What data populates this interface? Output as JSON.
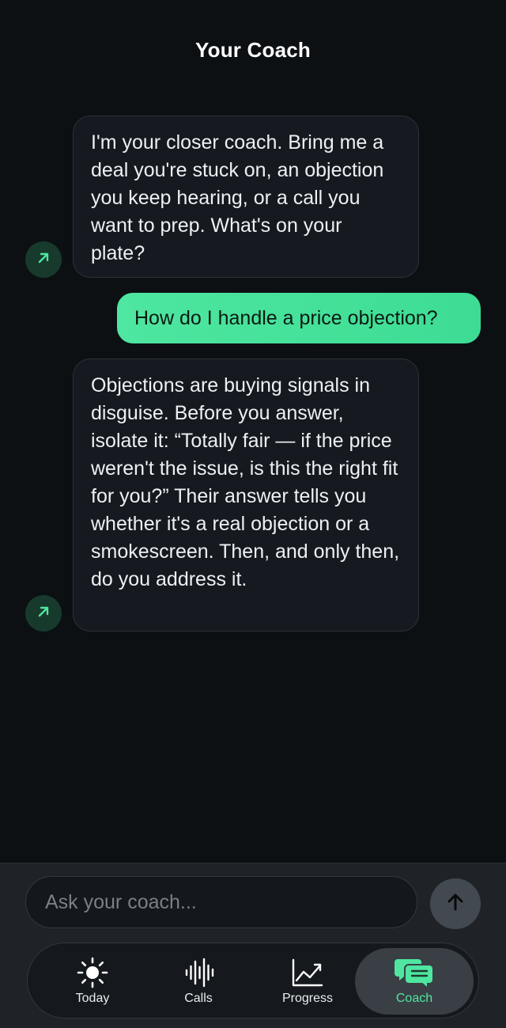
{
  "header": {
    "title": "Your Coach"
  },
  "messages": [
    {
      "role": "coach",
      "text": "I'm your closer coach. Bring me a deal you're stuck on, an objection you keep hearing, or a call you want to prep. What's on your plate?"
    },
    {
      "role": "user",
      "text": "How do I handle a price objection?"
    },
    {
      "role": "coach",
      "text": "Objections are buying signals in disguise. Before you answer, isolate it: “Totally fair — if the price weren't the issue, is this the right fit for you?” Their answer tells you whether it's a real objection or a smokescreen. Then, and only then, do you address it."
    }
  ],
  "composer": {
    "placeholder": "Ask your coach...",
    "value": "",
    "send_icon": "arrow-up-icon"
  },
  "tabs": [
    {
      "label": "Today",
      "icon": "sun-icon",
      "active": false
    },
    {
      "label": "Calls",
      "icon": "waveform-icon",
      "active": false
    },
    {
      "label": "Progress",
      "icon": "trend-chart-icon",
      "active": false
    },
    {
      "label": "Coach",
      "icon": "chat-bubbles-icon",
      "active": true
    }
  ],
  "colors": {
    "background": "#0c1013",
    "accent": "#4ee6a0",
    "coach_bubble": "#161a20",
    "avatar_bg": "#173a2c"
  }
}
